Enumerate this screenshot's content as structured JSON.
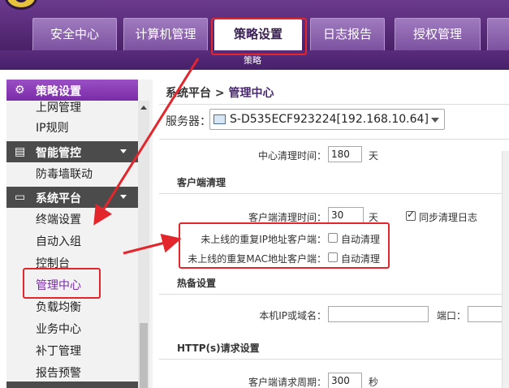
{
  "top_nav": {
    "tabs": [
      {
        "label": "安全中心"
      },
      {
        "label": "计算机管理"
      },
      {
        "label": "策略设置",
        "active": true
      },
      {
        "label": "日志报告"
      },
      {
        "label": "授权管理"
      }
    ],
    "subtab": "策略"
  },
  "sidebar": {
    "groups": [
      {
        "label": "策略设置",
        "icon": "gear-icon",
        "items": [
          "上网管理",
          "IP规则"
        ]
      },
      {
        "label": "智能管控",
        "icon": "control-panel-icon",
        "items": [
          "防毒墙联动"
        ]
      },
      {
        "label": "系统平台",
        "icon": "monitor-icon",
        "items": [
          "终端设置",
          "自动入组",
          "控制台",
          "管理中心",
          "负载均衡",
          "业务中心",
          "补丁管理",
          "报告预警"
        ],
        "selected": "管理中心"
      }
    ]
  },
  "breadcrumb": {
    "root": "系统平台",
    "separator": ">",
    "current": "管理中心"
  },
  "server": {
    "label": "服务器：",
    "value": "S-D535ECF923224[192.168.10.64]",
    "icon": "server-icon"
  },
  "center_cleanup": {
    "label": "中心清理时间：",
    "value": "180",
    "unit": "天"
  },
  "client_cleanup": {
    "section": "客户端清理",
    "time_label": "客户端清理时间：",
    "time_value": "30",
    "unit": "天",
    "sync_label": "同步清理日志",
    "sync_checked": true,
    "dup_ip_label": "未上线的重复IP地址客户端：",
    "dup_ip_cb": "自动清理",
    "dup_ip_checked": false,
    "dup_mac_label": "未上线的重复MAC地址客户端：",
    "dup_mac_cb": "自动清理",
    "dup_mac_checked": false
  },
  "hot_standby": {
    "section": "热备设置",
    "ip_label": "本机IP或域名：",
    "ip_value": "",
    "port_label": "端口：",
    "port_value": ""
  },
  "http": {
    "section": "HTTP(s)请求设置",
    "period_label": "客户端请求周期：",
    "period_value": "300",
    "unit": "秒"
  },
  "annotation_color": "#e3262c",
  "accent_color": "#7a2ca8"
}
